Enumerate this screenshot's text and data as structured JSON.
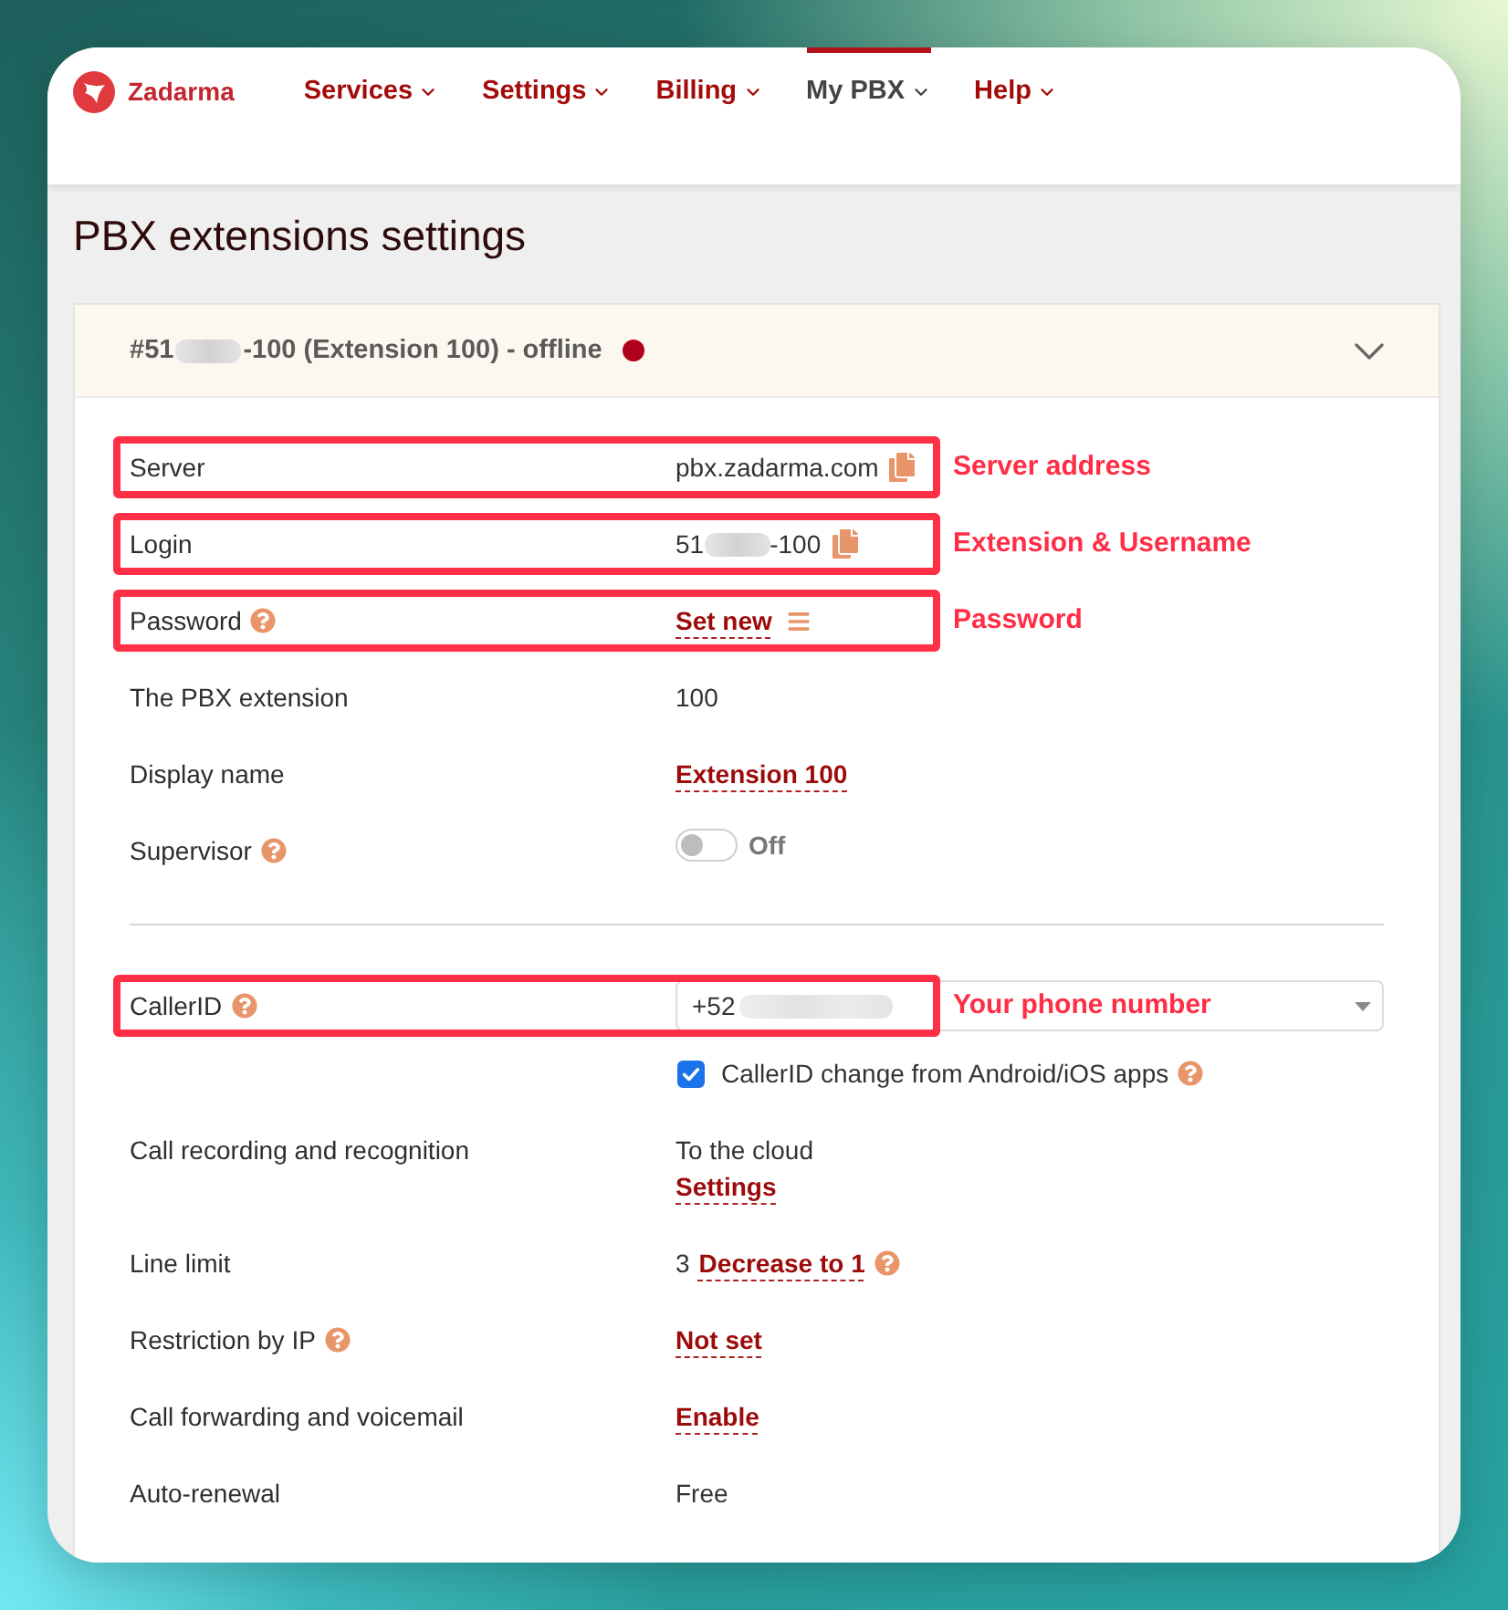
{
  "nav": {
    "logo": "Zadarma",
    "items": [
      {
        "label": "Services",
        "selected": false
      },
      {
        "label": "Settings",
        "selected": false
      },
      {
        "label": "Billing",
        "selected": false
      },
      {
        "label": "My PBX",
        "selected": true
      },
      {
        "label": "Help",
        "selected": false
      }
    ]
  },
  "page_title": "PBX extensions settings",
  "extension": {
    "title": [
      {
        "kind": "text",
        "text": "#51"
      },
      {
        "kind": "redacted"
      },
      {
        "kind": "text",
        "text": "-100 (Extension 100) - offline"
      }
    ],
    "sections": [
      [
        {
          "label": "Server",
          "help": false,
          "annotation": "Server address",
          "lines": [
            [
              {
                "kind": "text",
                "text": "pbx.zadarma.com"
              },
              {
                "kind": "copy"
              }
            ]
          ]
        },
        {
          "label": "Login",
          "help": false,
          "annotation": "Extension & Username",
          "lines": [
            [
              {
                "kind": "text",
                "text": "51"
              },
              {
                "kind": "redacted"
              },
              {
                "kind": "text",
                "text": "-100"
              },
              {
                "kind": "copy"
              }
            ]
          ]
        },
        {
          "label": "Password",
          "help": true,
          "annotation": "Password",
          "lines": [
            [
              {
                "kind": "link",
                "text": "Set new"
              },
              {
                "kind": "menu"
              }
            ]
          ]
        },
        {
          "label": "The PBX extension",
          "help": false,
          "lines": [
            [
              {
                "kind": "text",
                "text": "100"
              }
            ]
          ]
        },
        {
          "label": "Display name",
          "help": false,
          "lines": [
            [
              {
                "kind": "link",
                "text": "Extension 100"
              }
            ]
          ]
        },
        {
          "label": "Supervisor",
          "help": true,
          "lines": [
            [
              {
                "kind": "toggle",
                "on": false,
                "text": "Off"
              }
            ]
          ]
        }
      ],
      [
        {
          "label": "CallerID",
          "help": true,
          "annotation": "Your phone number",
          "lines": [
            [
              {
                "kind": "select",
                "parts": [
                  {
                    "kind": "text",
                    "text": "+52"
                  },
                  {
                    "kind": "redacted"
                  }
                ]
              }
            ],
            [
              {
                "kind": "checkbox",
                "checked": true,
                "text": "CallerID change from Android/iOS apps"
              },
              {
                "kind": "help"
              }
            ]
          ]
        },
        {
          "label": "Call recording and recognition",
          "help": false,
          "lines": [
            [
              {
                "kind": "text",
                "text": "To the cloud"
              }
            ],
            [
              {
                "kind": "link",
                "text": "Settings"
              }
            ]
          ]
        },
        {
          "label": "Line limit",
          "help": false,
          "lines": [
            [
              {
                "kind": "text",
                "text": "3"
              },
              {
                "kind": "link",
                "text": "Decrease to 1"
              },
              {
                "kind": "help"
              }
            ]
          ]
        },
        {
          "label": "Restriction by IP",
          "help": true,
          "lines": [
            [
              {
                "kind": "link",
                "text": "Not set"
              }
            ]
          ]
        },
        {
          "label": "Call forwarding and voicemail",
          "help": false,
          "lines": [
            [
              {
                "kind": "link",
                "text": "Enable"
              }
            ]
          ]
        },
        {
          "label": "Auto-renewal",
          "help": false,
          "lines": [
            [
              {
                "kind": "text",
                "text": "Free"
              }
            ]
          ]
        }
      ]
    ]
  }
}
